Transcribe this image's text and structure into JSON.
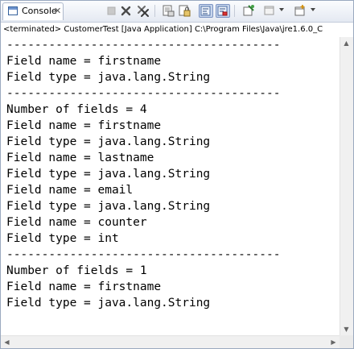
{
  "window": {
    "tab": {
      "label": "Console",
      "icon": "console-icon",
      "close": "✕"
    },
    "toolbar": [
      {
        "name": "terminate-button",
        "icon": "stop-icon"
      },
      {
        "name": "remove-launch-button",
        "icon": "remove-launch-icon"
      },
      {
        "name": "remove-all-terminated-button",
        "icon": "remove-all-icon"
      },
      {
        "name": "clear-console-button",
        "icon": "clear-console-icon"
      },
      {
        "name": "scroll-lock-button",
        "icon": "scroll-lock-icon"
      },
      {
        "name": "word-wrap-button",
        "icon": "word-wrap-icon"
      },
      {
        "name": "show-console-on-output-button",
        "icon": "show-output-icon"
      },
      {
        "name": "pin-console-button",
        "icon": "pin-icon"
      },
      {
        "name": "display-selected-console-button",
        "icon": "display-console-icon"
      },
      {
        "name": "open-console-button",
        "icon": "open-console-icon"
      }
    ]
  },
  "status_line": "<terminated> CustomerTest [Java Application] C:\\Program Files\\Java\\jre1.6.0_C",
  "console_lines": [
    "---------------------------------------",
    "Field name = firstname",
    "Field type = java.lang.String",
    "---------------------------------------",
    "Number of fields = 4",
    "Field name = firstname",
    "Field type = java.lang.String",
    "Field name = lastname",
    "Field type = java.lang.String",
    "Field name = email",
    "Field type = java.lang.String",
    "Field name = counter",
    "Field type = int",
    "---------------------------------------",
    "Number of fields = 1",
    "Field name = firstname",
    "Field type = java.lang.String"
  ],
  "colors": {
    "window_border": "#9aa9bf",
    "toolbar_toggle": "#c7d5ec",
    "text": "#000000"
  }
}
